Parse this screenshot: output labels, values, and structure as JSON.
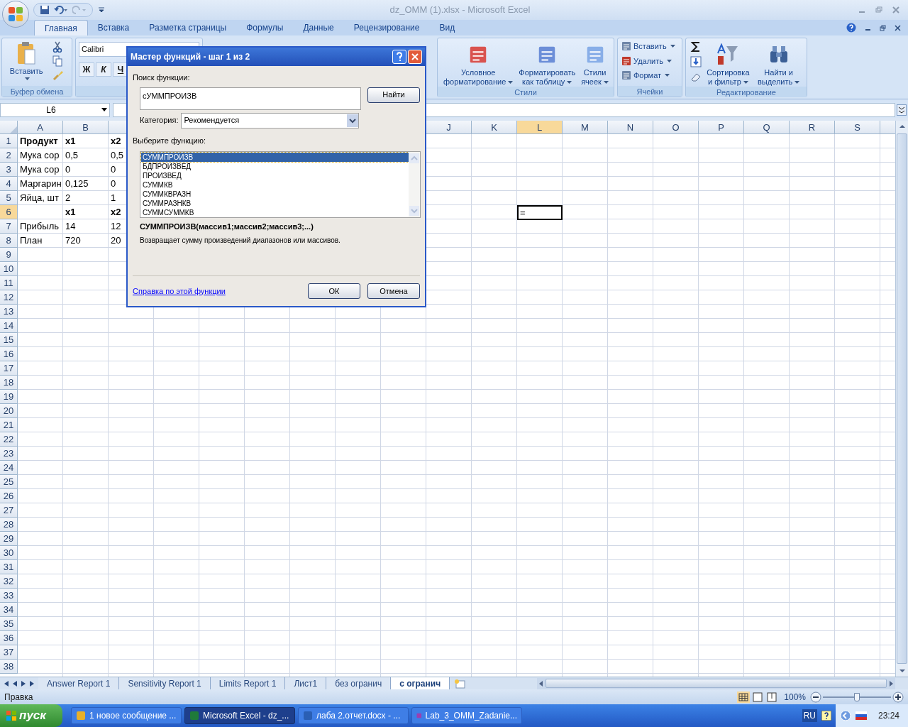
{
  "window": {
    "title": "dz_OMM (1).xlsx - Microsoft Excel"
  },
  "ribbon_tabs": [
    {
      "label": "Главная",
      "selected": true
    },
    {
      "label": "Вставка",
      "selected": false
    },
    {
      "label": "Разметка страницы",
      "selected": false
    },
    {
      "label": "Формулы",
      "selected": false
    },
    {
      "label": "Данные",
      "selected": false
    },
    {
      "label": "Рецензирование",
      "selected": false
    },
    {
      "label": "Вид",
      "selected": false
    }
  ],
  "clipboard": {
    "paste": "Вставить",
    "label": "Буфер обмена"
  },
  "font": {
    "name": "Calibri",
    "buttons": [
      "Ж",
      "К",
      "Ч"
    ]
  },
  "styles": {
    "label": "Стили",
    "buttons": [
      {
        "line1": "Условное",
        "line2": "форматирование"
      },
      {
        "line1": "Форматировать",
        "line2": "как таблицу"
      },
      {
        "line1": "Стили",
        "line2": "ячеек"
      }
    ]
  },
  "cells_group": {
    "label": "Ячейки",
    "buttons": [
      "Вставить",
      "Удалить",
      "Формат"
    ]
  },
  "editing": {
    "label": "Редактирование",
    "buttons": [
      {
        "line1": "Сортировка",
        "line2": "и фильтр"
      },
      {
        "line1": "Найти и",
        "line2": "выделить"
      }
    ]
  },
  "name_box": "L6",
  "columns_left": [
    {
      "label": "A",
      "selected": false
    },
    {
      "label": "B",
      "selected": false
    }
  ],
  "columns_right": [
    {
      "label": "J",
      "selected": false
    },
    {
      "label": "K",
      "selected": false
    },
    {
      "label": "L",
      "selected": true
    },
    {
      "label": "M",
      "selected": false
    },
    {
      "label": "N",
      "selected": false
    },
    {
      "label": "O",
      "selected": false
    },
    {
      "label": "P",
      "selected": false
    },
    {
      "label": "Q",
      "selected": false
    },
    {
      "label": "R",
      "selected": false
    },
    {
      "label": "S",
      "selected": false
    }
  ],
  "rows": [
    {
      "label": "1",
      "selected": false,
      "bold": true,
      "a": "Продукт",
      "b": "x1",
      "c": "x2"
    },
    {
      "label": "2",
      "selected": false,
      "bold": false,
      "a": "Мука сор",
      "b": "0,5",
      "c": "0,5"
    },
    {
      "label": "3",
      "selected": false,
      "bold": false,
      "a": "Мука сор",
      "b": "0",
      "c": "0"
    },
    {
      "label": "4",
      "selected": false,
      "bold": false,
      "a": "Маргарин",
      "b": "0,125",
      "c": "0"
    },
    {
      "label": "5",
      "selected": false,
      "bold": false,
      "a": "Яйца, шт",
      "b": "2",
      "c": "1"
    },
    {
      "label": "6",
      "selected": true,
      "bold": true,
      "b": "x1",
      "c": "x2",
      "l": "="
    },
    {
      "label": "7",
      "selected": false,
      "bold": false,
      "a": "Прибыль",
      "b": "14",
      "c": "12"
    },
    {
      "label": "8",
      "selected": false,
      "bold": false,
      "a": "План",
      "b": "720",
      "c": "20"
    },
    {
      "label": "9",
      "selected": false
    },
    {
      "label": "10",
      "selected": false
    },
    {
      "label": "11",
      "selected": false
    },
    {
      "label": "12",
      "selected": false
    },
    {
      "label": "13",
      "selected": false
    },
    {
      "label": "14",
      "selected": false
    },
    {
      "label": "15",
      "selected": false
    },
    {
      "label": "16",
      "selected": false
    },
    {
      "label": "17",
      "selected": false
    },
    {
      "label": "18",
      "selected": false
    },
    {
      "label": "19",
      "selected": false
    },
    {
      "label": "20",
      "selected": false
    },
    {
      "label": "21",
      "selected": false
    },
    {
      "label": "22",
      "selected": false
    },
    {
      "label": "23",
      "selected": false
    },
    {
      "label": "24",
      "selected": false
    },
    {
      "label": "25",
      "selected": false
    },
    {
      "label": "26",
      "selected": false
    },
    {
      "label": "27",
      "selected": false
    },
    {
      "label": "28",
      "selected": false
    },
    {
      "label": "29",
      "selected": false
    },
    {
      "label": "30",
      "selected": false
    },
    {
      "label": "31",
      "selected": false
    },
    {
      "label": "32",
      "selected": false
    },
    {
      "label": "33",
      "selected": false
    },
    {
      "label": "34",
      "selected": false
    },
    {
      "label": "35",
      "selected": false
    },
    {
      "label": "36",
      "selected": false
    },
    {
      "label": "37",
      "selected": false
    },
    {
      "label": "38",
      "selected": false
    }
  ],
  "dialog": {
    "title": "Мастер функций - шаг 1 из 2",
    "search_label": "Поиск функции:",
    "search_value": "сУММПРОИЗВ",
    "find_button": "Найти",
    "category_label": "Категория:",
    "category_value": "Рекомендуется",
    "list_label": "Выберите функцию:",
    "functions": [
      {
        "label": "СУММПРОИЗВ",
        "selected": true
      },
      {
        "label": "БДПРОИЗВЕД",
        "selected": false
      },
      {
        "label": "ПРОИЗВЕД",
        "selected": false
      },
      {
        "label": "СУММКВ",
        "selected": false
      },
      {
        "label": "СУММКВРАЗН",
        "selected": false
      },
      {
        "label": "СУММРАЗНКВ",
        "selected": false
      },
      {
        "label": "СУММСУММКВ",
        "selected": false
      }
    ],
    "signature": "СУММПРОИЗВ(массив1;массив2;массив3;...)",
    "description": "Возвращает сумму произведений диапазонов или массивов.",
    "help_link": "Справка по этой функции",
    "ok": "ОК",
    "cancel": "Отмена"
  },
  "sheet_tabs": [
    {
      "label": "Answer Report 1",
      "selected": false
    },
    {
      "label": "Sensitivity Report 1",
      "selected": false
    },
    {
      "label": "Limits Report 1",
      "selected": false
    },
    {
      "label": "Лист1",
      "selected": false
    },
    {
      "label": "без огранич",
      "selected": false
    },
    {
      "label": "с огранич",
      "selected": true
    }
  ],
  "status_bar": {
    "mode": "Правка",
    "zoom": "100%",
    "level": 0.5
  },
  "taskbar": {
    "start": "пуск",
    "items": [
      {
        "label": "1 новое сообщение ...",
        "selected": false
      },
      {
        "label": "Microsoft Excel - dz_...",
        "selected": true
      },
      {
        "label": "лаба 2.отчет.docx - ...",
        "selected": false
      },
      {
        "label": "Lab_3_OMM_Zadanie...",
        "selected": false
      }
    ],
    "language": "RU",
    "clock": "23:24"
  }
}
